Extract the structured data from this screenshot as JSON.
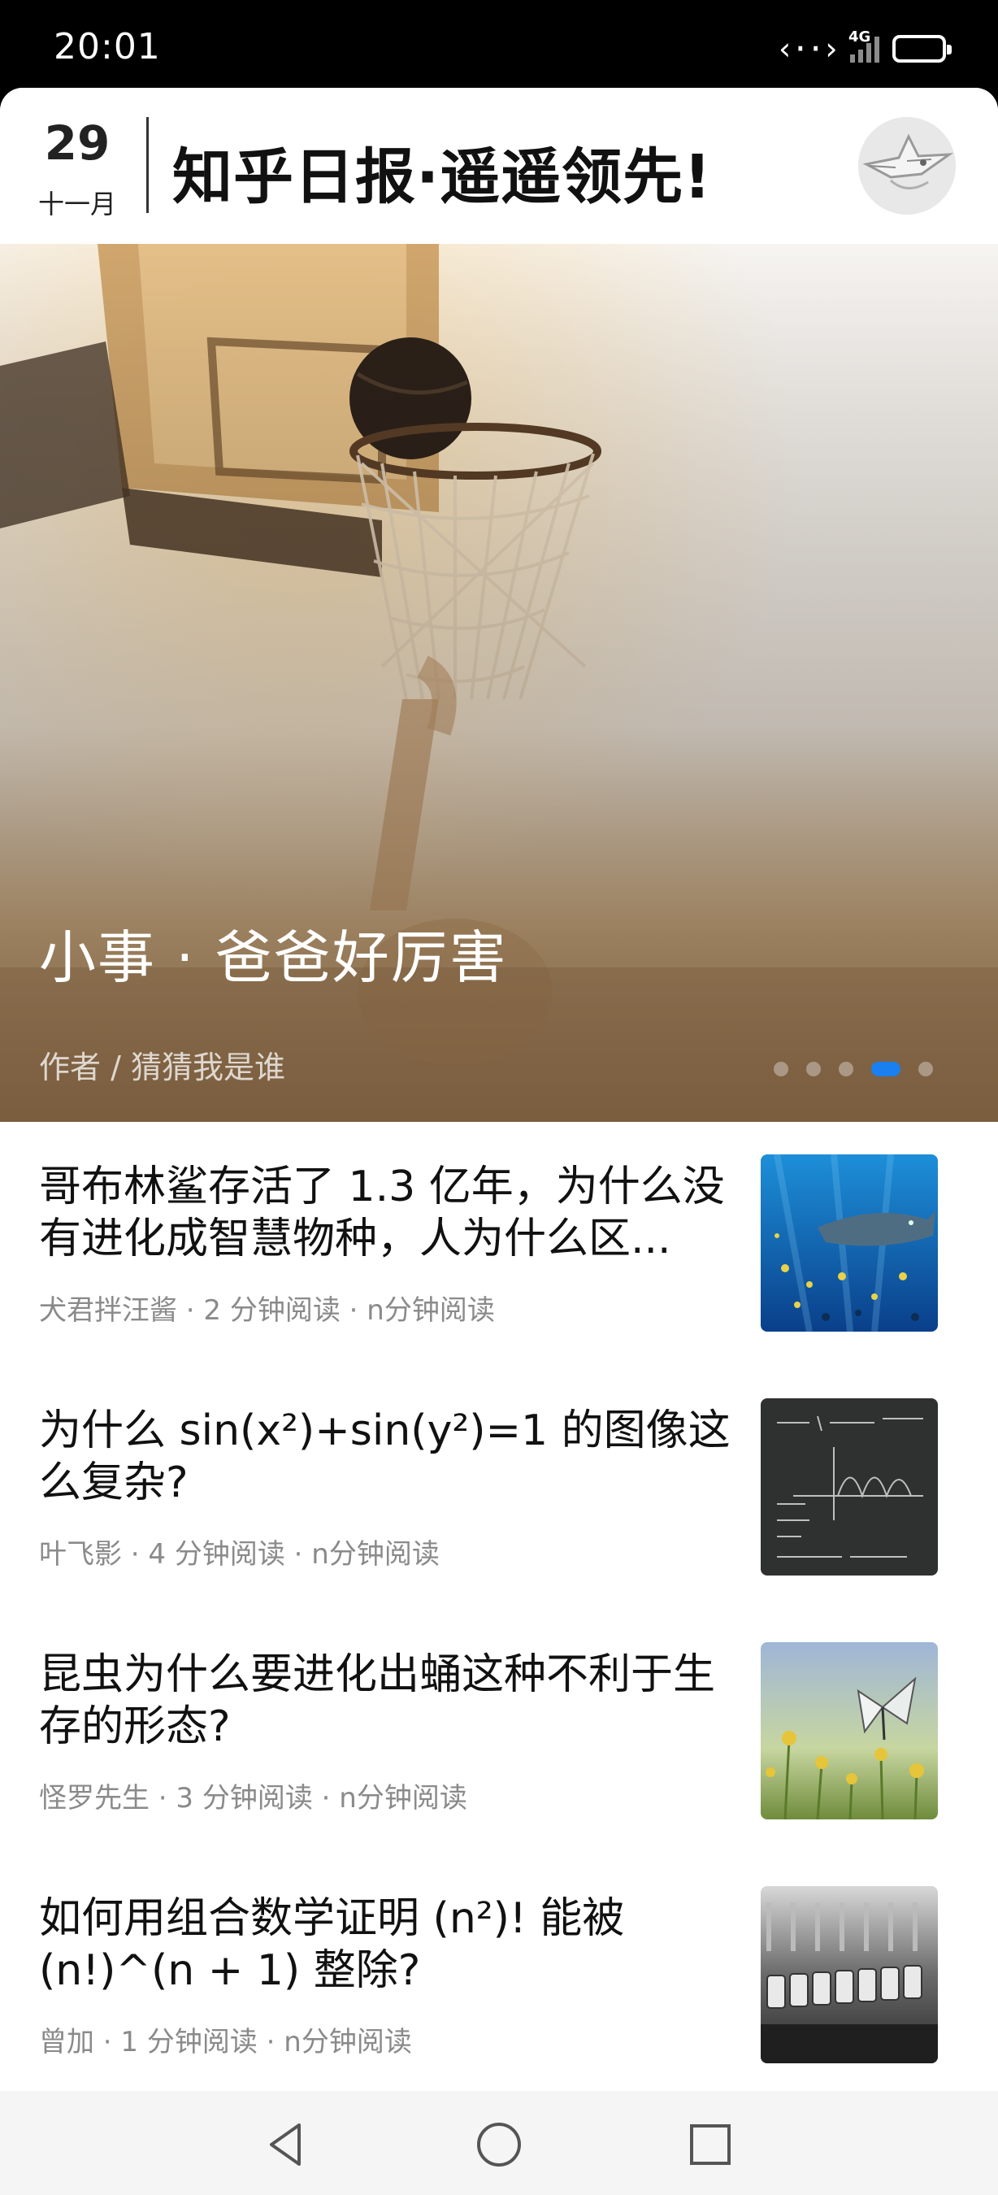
{
  "status_bar": {
    "time": "20:01",
    "network_label": "4G",
    "icons": [
      "data-transfer-icon",
      "cellular-signal-icon",
      "battery-icon"
    ]
  },
  "header": {
    "day": "29",
    "month": "十一月",
    "title": "知乎日报·遥遥领先!",
    "avatar_icon": "avatar-icon"
  },
  "banner": {
    "title": "小事 · 爸爸好厉害",
    "author": "作者 / 猜猜我是谁",
    "dots_total": 5,
    "active_dot": 4,
    "image": "basketball-hoop-photo"
  },
  "feed": {
    "items": [
      {
        "title": "哥布林鲨存活了 1.3 亿年，为什么没有进化成智慧物种，人为什么区...",
        "meta": "犬君拌汪酱 · 2 分钟阅读 · n分钟阅读",
        "image": "whale-shark-underwater-photo"
      },
      {
        "title": "为什么 sin(x²)+sin(y²)=1 的图像这么复杂?",
        "meta": "叶飞影 · 4 分钟阅读 · n分钟阅读",
        "image": "chalkboard-math-photo"
      },
      {
        "title": "昆虫为什么要进化出蛹这种不利于生存的形态?",
        "meta": "怪罗先生 · 3 分钟阅读 · n分钟阅读",
        "image": "butterfly-flowers-photo"
      },
      {
        "title": "如何用组合数学证明 (n²)! 能被 (n!)^(n + 1) 整除?",
        "meta": "曾加 · 1 分钟阅读 · n分钟阅读",
        "image": "number-counter-photo"
      }
    ]
  },
  "nav_bar": {
    "buttons": [
      "back-icon",
      "home-icon",
      "recents-icon"
    ]
  },
  "colors": {
    "accent": "#1a7ff0",
    "meta_text": "#8a8a8a",
    "title_text": "#111111"
  }
}
